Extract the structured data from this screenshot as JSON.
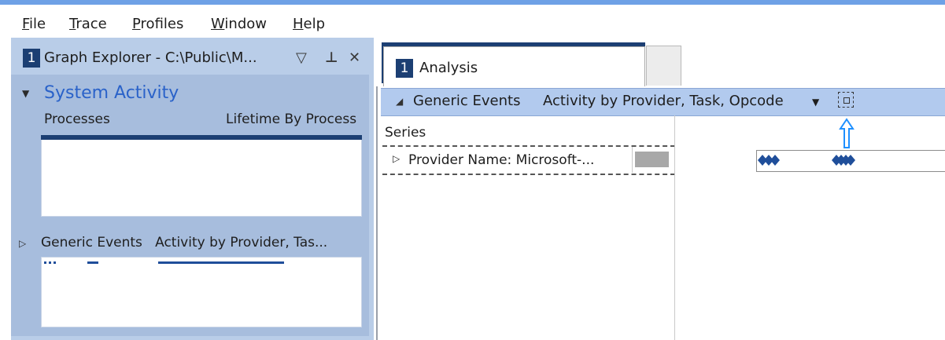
{
  "menu": {
    "items": [
      "File",
      "Trace",
      "Profiles",
      "Window",
      "Help"
    ]
  },
  "graph_explorer": {
    "number": "1",
    "title": "Graph Explorer - C:\\Public\\M...",
    "buttons": {
      "dropdown": "▽",
      "pin": "⊥",
      "close": "✕"
    },
    "system_activity": {
      "title": "System Activity",
      "graph_name": "Processes",
      "preset": "Lifetime By Process"
    },
    "generic_events": {
      "name": "Generic Events",
      "preset": "Activity by Provider, Tas..."
    }
  },
  "analysis": {
    "tab_number": "1",
    "tab_title": "Analysis",
    "graph_header": {
      "name": "Generic Events",
      "preset": "Activity by Provider, Task, Opcode",
      "collapse_glyph": "◢",
      "dropdown_glyph": "▼"
    },
    "series_header": "Series",
    "rows": [
      {
        "label": "Provider Name: Microsoft-...",
        "swatch_color": "#a8a8a8"
      }
    ]
  },
  "colors": {
    "accent_blue": "#1c3f73",
    "link_blue": "#2a62c9",
    "panel_bg": "#b9cde8",
    "header_bg": "#b2caee",
    "arrow_blue": "#1e90ff",
    "diamond_blue": "#1f4e9a"
  }
}
